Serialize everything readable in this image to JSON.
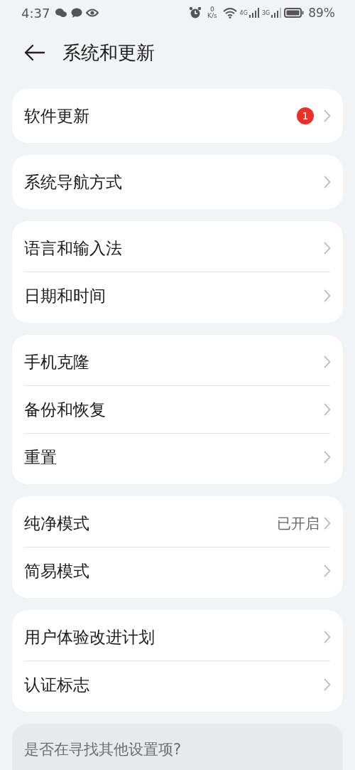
{
  "status_bar": {
    "time": "4:37",
    "speed_value": "0",
    "speed_unit": "K/s",
    "sim1_network": "4G",
    "sim2_network": "3G",
    "battery": "89%"
  },
  "header": {
    "title": "系统和更新"
  },
  "groups": [
    {
      "items": [
        {
          "label": "软件更新",
          "badge": "1"
        }
      ]
    },
    {
      "items": [
        {
          "label": "系统导航方式"
        }
      ]
    },
    {
      "items": [
        {
          "label": "语言和输入法"
        },
        {
          "label": "日期和时间"
        }
      ]
    },
    {
      "items": [
        {
          "label": "手机克隆"
        },
        {
          "label": "备份和恢复"
        },
        {
          "label": "重置"
        }
      ]
    },
    {
      "items": [
        {
          "label": "纯净模式",
          "value": "已开启"
        },
        {
          "label": "简易模式"
        }
      ]
    },
    {
      "items": [
        {
          "label": "用户体验改进计划"
        },
        {
          "label": "认证标志"
        }
      ]
    }
  ],
  "suggestion": {
    "text": "是否在寻找其他设置项?"
  }
}
